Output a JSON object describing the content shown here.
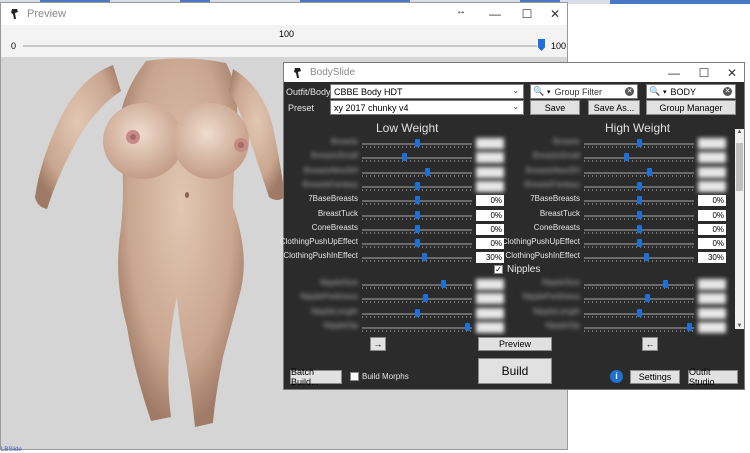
{
  "preview": {
    "title": "Preview",
    "slider": {
      "min_label": "0",
      "current_label": "100",
      "max_label": "100",
      "value": 100,
      "max": 100
    },
    "bottom_text": "LBSlide"
  },
  "bodyslide": {
    "title": "BodySlide",
    "outfit_label": "Outfit/Body",
    "outfit_value": "CBBE Body HDT",
    "preset_label": "Preset",
    "preset_value": "xy 2017 chunky v4",
    "group_filter_placeholder": "Group Filter",
    "outfit_filter_value": "BODY",
    "save_label": "Save",
    "save_as_label": "Save As...",
    "group_manager_label": "Group Manager",
    "low_weight": "Low Weight",
    "high_weight": "High Weight",
    "rows_top": [
      {
        "label": "Breasts",
        "blurred": true,
        "low": 50,
        "high": 50,
        "low_val": "",
        "high_val": ""
      },
      {
        "label": "BreastsSmall",
        "blurred": true,
        "low": 38,
        "high": 38,
        "low_val": "",
        "high_val": ""
      },
      {
        "label": "BreastsNewSH",
        "blurred": true,
        "low": 60,
        "high": 60,
        "low_val": "",
        "high_val": ""
      },
      {
        "label": "BreastsFantasy",
        "blurred": true,
        "low": 50,
        "high": 50,
        "low_val": "",
        "high_val": ""
      },
      {
        "label": "7BaseBreasts",
        "blurred": false,
        "low": 50,
        "high": 50,
        "low_val": "0%",
        "high_val": "0%"
      },
      {
        "label": "BreastTuck",
        "blurred": false,
        "low": 50,
        "high": 50,
        "low_val": "0%",
        "high_val": "0%"
      },
      {
        "label": "ConeBreasts",
        "blurred": false,
        "low": 50,
        "high": 50,
        "low_val": "0%",
        "high_val": "0%"
      },
      {
        "label": "ClothingPushUpEffect",
        "blurred": false,
        "low": 50,
        "high": 50,
        "low_val": "0%",
        "high_val": "0%"
      },
      {
        "label": "ClothingPushInEffect",
        "blurred": false,
        "low": 57,
        "high": 57,
        "low_val": "30%",
        "high_val": "30%"
      }
    ],
    "nipples_section": "Nipples",
    "rows_bottom": [
      {
        "label": "NippleSize",
        "blurred": true,
        "low": 75,
        "high": 75
      },
      {
        "label": "NipplePerkiness",
        "blurred": true,
        "low": 58,
        "high": 58
      },
      {
        "label": "NippleLength",
        "blurred": true,
        "low": 50,
        "high": 50
      },
      {
        "label": "NippleDip",
        "blurred": true,
        "low": 98,
        "high": 98
      }
    ],
    "arrow_right": "→",
    "arrow_left": "←",
    "preview_label": "Preview",
    "build_label": "Build",
    "batch_build_label": "Batch Build...",
    "build_morphs_label": "Build Morphs",
    "settings_label": "Settings",
    "outfit_studio_label": "Outfit Studio"
  }
}
